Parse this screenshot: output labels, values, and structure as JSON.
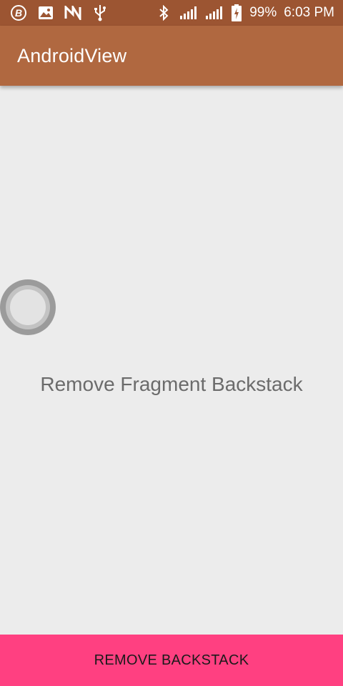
{
  "status_bar": {
    "left_icons": [
      "b-app-icon",
      "image-icon",
      "n-icon",
      "usb-icon"
    ],
    "right_icons": [
      "bluetooth-icon",
      "signal-icon",
      "signal-icon",
      "battery-icon"
    ],
    "battery": "99%",
    "time": "6:03 PM",
    "background_color": "#9c5532"
  },
  "app_bar": {
    "title": "AndroidView",
    "background_color": "#b06840"
  },
  "main": {
    "label": "Remove Fragment Backstack"
  },
  "bottom_button": {
    "label": "REMOVE BACKSTACK",
    "background_color": "#ff4081"
  }
}
